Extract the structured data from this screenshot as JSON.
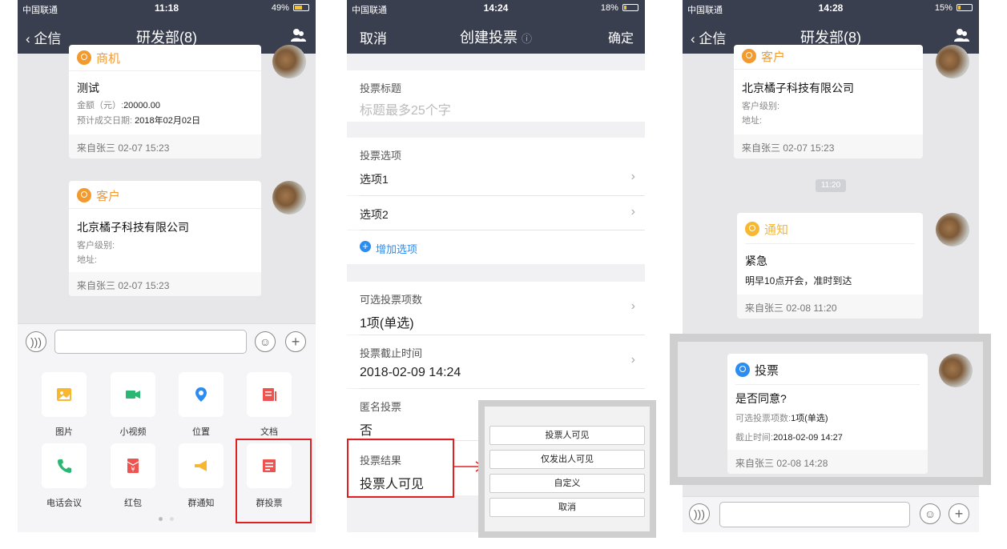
{
  "status": {
    "carrier": "中国联通",
    "p1_time": "11:18",
    "p1_batt": "49%",
    "p2_time": "14:24",
    "p2_batt": "18%",
    "p3_time": "14:28",
    "p3_batt": "15%"
  },
  "chat": {
    "back_label": "企信",
    "title": "研发部(8)"
  },
  "p1": {
    "opportunity": {
      "type": "商机",
      "name": "测试",
      "amount_label": "金额（元）:",
      "amount": "20000.00",
      "date_label": "预计成交日期:",
      "date": "2018年02月02日",
      "from": "来自张三 02-07 15:23"
    },
    "customer": {
      "type": "客户",
      "name": "北京橘子科技有限公司",
      "level_label": "客户级别:",
      "address_label": "地址:",
      "from": "来自张三 02-07 15:23"
    },
    "grid": [
      {
        "label": "图片",
        "icon": "image-icon"
      },
      {
        "label": "小视频",
        "icon": "video-icon"
      },
      {
        "label": "位置",
        "icon": "location-icon"
      },
      {
        "label": "文档",
        "icon": "document-icon"
      },
      {
        "label": "电话会议",
        "icon": "phone-icon"
      },
      {
        "label": "红包",
        "icon": "red-packet-icon"
      },
      {
        "label": "群通知",
        "icon": "megaphone-icon"
      },
      {
        "label": "群投票",
        "icon": "vote-icon"
      }
    ]
  },
  "p2": {
    "nav": {
      "cancel": "取消",
      "title": "创建投票",
      "confirm": "确定"
    },
    "vote_title_label": "投票标题",
    "vote_title_placeholder": "标题最多25个字",
    "options_label": "投票选项",
    "option1": "选项1",
    "option2": "选项2",
    "add_option": "增加选项",
    "max_choices_label": "可选投票项数",
    "max_choices_value": "1项(单选)",
    "deadline_label": "投票截止时间",
    "deadline_value": "2018-02-09 14:24",
    "anonymous_label": "匿名投票",
    "anonymous_value": "否",
    "result_label": "投票结果",
    "result_value": "投票人可见",
    "popup": [
      "投票人可见",
      "仅发出人可见",
      "自定义",
      "取消"
    ]
  },
  "p3": {
    "customer": {
      "type": "客户",
      "name": "北京橘子科技有限公司",
      "level_label": "客户级别:",
      "address_label": "地址:",
      "from": "来自张三 02-07 15:23"
    },
    "time_divider": "11:20",
    "notice": {
      "type": "通知",
      "title": "紧急",
      "body": "明早10点开会，准时到达",
      "from": "来自张三 02-08 11:20"
    },
    "vote": {
      "type": "投票",
      "question": "是否同意?",
      "choices_label": "可选投票项数:",
      "choices_value": "1项(单选)",
      "deadline_label": "截止时间:",
      "deadline_value": "2018-02-09 14:27",
      "from": "来自张三 02-08 14:28"
    }
  },
  "colors": {
    "nav_bg": "#3a3f4f",
    "accent_orange": "#f29a2e",
    "accent_blue": "#2d8cf0",
    "red_box": "#e02020"
  }
}
